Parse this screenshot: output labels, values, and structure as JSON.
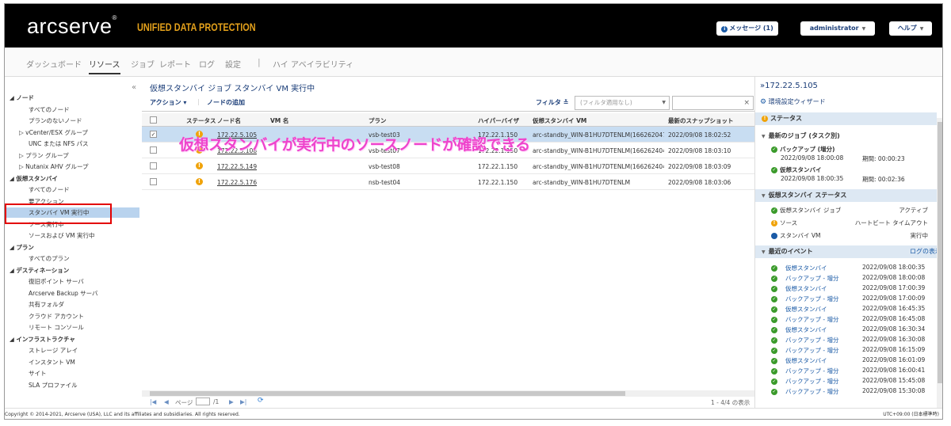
{
  "header": {
    "logo": "arcserve",
    "logo_mark": "®",
    "product": "UNIFIED DATA PROTECTION",
    "messages_label": "メッセージ (1)",
    "user_label": "administrator",
    "help_label": "ヘルプ"
  },
  "nav": {
    "items": [
      "ダッシュボード",
      "リソース",
      "ジョブ",
      "レポート",
      "ログ",
      "設定"
    ],
    "separator": "|",
    "ha": "ハイ アベイラビリティ"
  },
  "sidebar": {
    "items": [
      {
        "label": "◢ ノード",
        "bold": true
      },
      {
        "label": "すべてのノード"
      },
      {
        "label": "プランのないノード"
      },
      {
        "label": "▷ vCenter/ESX グループ"
      },
      {
        "label": "UNC または NFS パス"
      },
      {
        "label": "▷ プラン グループ"
      },
      {
        "label": "▷ Nutanix AHV グループ"
      },
      {
        "label": "◢ 仮想スタンバイ",
        "bold": true
      },
      {
        "label": "すべてのノード"
      },
      {
        "label": "要アクション"
      },
      {
        "label": "スタンバイ VM 実行中",
        "selected": true
      },
      {
        "label": "ソース実行中"
      },
      {
        "label": "ソースおよび VM 実行中"
      },
      {
        "label": "◢ プラン",
        "bold": true
      },
      {
        "label": "すべてのプラン"
      },
      {
        "label": "◢ デスティネーション",
        "bold": true
      },
      {
        "label": "復旧ポイント サーバ"
      },
      {
        "label": "Arcserve Backup サーバ"
      },
      {
        "label": "共有フォルダ"
      },
      {
        "label": "クラウド アカウント"
      },
      {
        "label": "リモート コンソール"
      },
      {
        "label": "◢ インフラストラクチャ",
        "bold": true
      },
      {
        "label": "ストレージ アレイ"
      },
      {
        "label": "インスタント VM"
      },
      {
        "label": "サイト"
      },
      {
        "label": "SLA プロファイル"
      }
    ]
  },
  "main": {
    "title": "仮想スタンバイ ジョブ スタンバイ VM 実行中",
    "action": "アクション",
    "add_node": "ノードの追加",
    "filter_label": "フィルタ",
    "filter_value": "(フィルタ適用なし)",
    "search_clear": "×",
    "columns": [
      "ステータス",
      "ノード名",
      "VM 名",
      "プラン",
      "ハイパーバイザ",
      "仮想スタンバイ VM",
      "最新のスナップショット"
    ],
    "rows": [
      {
        "node": "172.22.5.105",
        "vm": "",
        "plan": "vsb-test03",
        "hv": "172.22.1.150",
        "svm": "arc-standby_WIN-B1HU7DTENLM(1662620472",
        "snap": "2022/09/08 18:02:52",
        "checked": true
      },
      {
        "node": "172.22.5.108",
        "vm": "",
        "plan": "vsb-test07",
        "hv": "172.22.1.150",
        "svm": "arc-standby_WIN-B1HU7DTENLM(16626240474",
        "snap": "2022/09/08 18:03:10",
        "checked": false
      },
      {
        "node": "172.22.5.149",
        "vm": "",
        "plan": "vsb-test08",
        "hv": "172.22.1.150",
        "svm": "arc-standby_WIN-B1HU7DTENLM(16626240433",
        "snap": "2022/09/08 18:03:09",
        "checked": false
      },
      {
        "node": "172.22.5.176",
        "vm": "",
        "plan": "nsb-test04",
        "hv": "172.22.1.150",
        "svm": "arc-standby_WIN-B1HU7DTENLM",
        "snap": "2022/09/08 18:03:06",
        "checked": false
      }
    ],
    "annotation": "仮想スタンバイが実行中のソースノードが確認できる",
    "pager": {
      "page_label": "ページ",
      "of": "/1",
      "count": "1 - 4/4 の表示"
    }
  },
  "right": {
    "title": "»172.22.5.105",
    "wizard": "環境設定ウィザード",
    "status_header": "ステータス",
    "latest_jobs_header": "最新のジョブ (タスク別)",
    "jobs": [
      {
        "name": "バックアップ (増分)",
        "time": "2022/09/08 18:00:08",
        "dur_label": "期間:",
        "dur": "00:00:23"
      },
      {
        "name": "仮想スタンバイ",
        "time": "2022/09/08 18:00:35",
        "dur_label": "期間:",
        "dur": "00:02:36"
      }
    ],
    "vsb_status_header": "仮想スタンバイ ステータス",
    "vsb_status": [
      {
        "label": "仮想スタンバイ ジョブ",
        "value": "アクティブ"
      },
      {
        "label": "ソース",
        "value": "ハートビート タイムアウト"
      },
      {
        "label": "スタンバイ VM",
        "value": "実行中"
      }
    ],
    "events_header": "最近のイベント",
    "log_link": "ログの表示",
    "events": [
      {
        "name": "仮想スタンバイ",
        "time": "2022/09/08 18:00:35"
      },
      {
        "name": "バックアップ - 増分",
        "time": "2022/09/08 18:00:08"
      },
      {
        "name": "仮想スタンバイ",
        "time": "2022/09/08 17:00:39"
      },
      {
        "name": "バックアップ - 増分",
        "time": "2022/09/08 17:00:09"
      },
      {
        "name": "仮想スタンバイ",
        "time": "2022/09/08 16:45:35"
      },
      {
        "name": "バックアップ - 増分",
        "time": "2022/09/08 16:45:08"
      },
      {
        "name": "仮想スタンバイ",
        "time": "2022/09/08 16:30:34"
      },
      {
        "name": "バックアップ - 増分",
        "time": "2022/09/08 16:30:08"
      },
      {
        "name": "バックアップ - 増分",
        "time": "2022/09/08 16:15:09"
      },
      {
        "name": "仮想スタンバイ",
        "time": "2022/09/08 16:01:09"
      },
      {
        "name": "バックアップ - 増分",
        "time": "2022/09/08 16:00:41"
      },
      {
        "name": "バックアップ - 増分",
        "time": "2022/09/08 15:45:08"
      },
      {
        "name": "バックアップ - 増分",
        "time": "2022/09/08 15:30:08"
      }
    ]
  },
  "footer": {
    "copyright": "Copyright © 2014-2021, Arcserve (USA), LLC and its affiliates and subsidiaries. All rights reserved.",
    "timezone": "UTC+09:00 (日本標準時)"
  }
}
